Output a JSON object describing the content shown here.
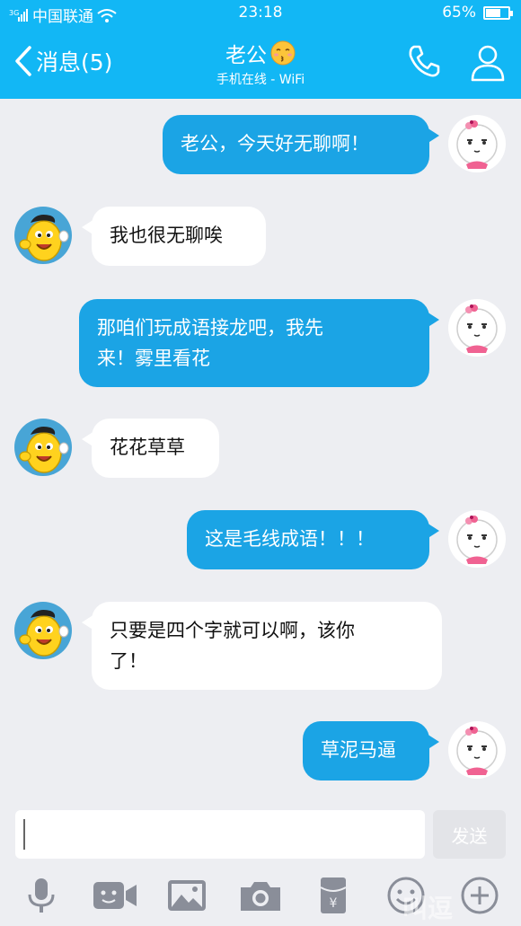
{
  "status_bar": {
    "carrier": "中国联通",
    "time": "23:18",
    "battery": "65%",
    "battery_level": 0.65
  },
  "header": {
    "back_label": "消息(5)",
    "title": "老公",
    "subtitle": "手机在线 - WiFi"
  },
  "messages": [
    {
      "side": "out",
      "text": "老公，今天好无聊啊！"
    },
    {
      "side": "in",
      "text": "我也很无聊唉"
    },
    {
      "side": "out",
      "line1": "那咱们玩成语接龙吧，我先",
      "line2": "来！雾里看花"
    },
    {
      "side": "in",
      "text": "花花草草"
    },
    {
      "side": "out",
      "text": "这是毛线成语！！！"
    },
    {
      "side": "in",
      "line1": "只要是四个字就可以啊，该你",
      "line2": "了！"
    },
    {
      "side": "out",
      "text": "草泥马逼"
    }
  ],
  "input": {
    "value": "",
    "send_label": "发送"
  },
  "toolbar": {
    "icons": [
      "microphone-icon",
      "video-call-icon",
      "image-icon",
      "camera-icon",
      "red-packet-icon",
      "emoji-icon",
      "plus-icon"
    ]
  },
  "watermark": "叫逗"
}
